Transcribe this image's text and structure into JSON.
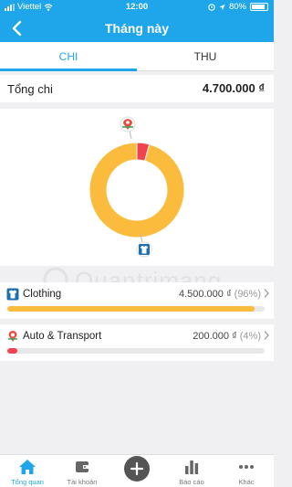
{
  "status_bar": {
    "carrier": "Viettel",
    "time": "12:00",
    "battery": "80%"
  },
  "nav": {
    "title": "Tháng này"
  },
  "tabs": [
    {
      "label": "CHI"
    },
    {
      "label": "THU"
    }
  ],
  "summary": {
    "label": "Tổng chi",
    "value": "4.700.000 ₫"
  },
  "chart_data": {
    "type": "pie",
    "categories": [
      "Clothing",
      "Auto & Transport"
    ],
    "values": [
      4500000,
      200000
    ],
    "percent": [
      96,
      4
    ],
    "colors": [
      "#fbbb3c",
      "#f0434f"
    ]
  },
  "categories": [
    {
      "name": "Clothing",
      "amount": "4.500.000 ₫",
      "percent": "(96%)",
      "fill": 0.96,
      "color": "#fbbb3c"
    },
    {
      "name": "Auto & Transport",
      "amount": "200.000 ₫",
      "percent": "(4%)",
      "fill": 0.04,
      "color": "#f0434f"
    }
  ],
  "watermark": "Quantrimang",
  "bottom_tabs": [
    {
      "label": "Tổng quan",
      "icon": "home-icon"
    },
    {
      "label": "Tài khoản",
      "icon": "wallet-icon"
    },
    {
      "label": "",
      "icon": "plus-icon"
    },
    {
      "label": "Báo cáo",
      "icon": "bar-chart-icon"
    },
    {
      "label": "Khác",
      "icon": "more-icon"
    }
  ],
  "colors": {
    "accent": "#1fa6ea",
    "clothing": "#fbbb3c",
    "transport": "#f0434f"
  }
}
